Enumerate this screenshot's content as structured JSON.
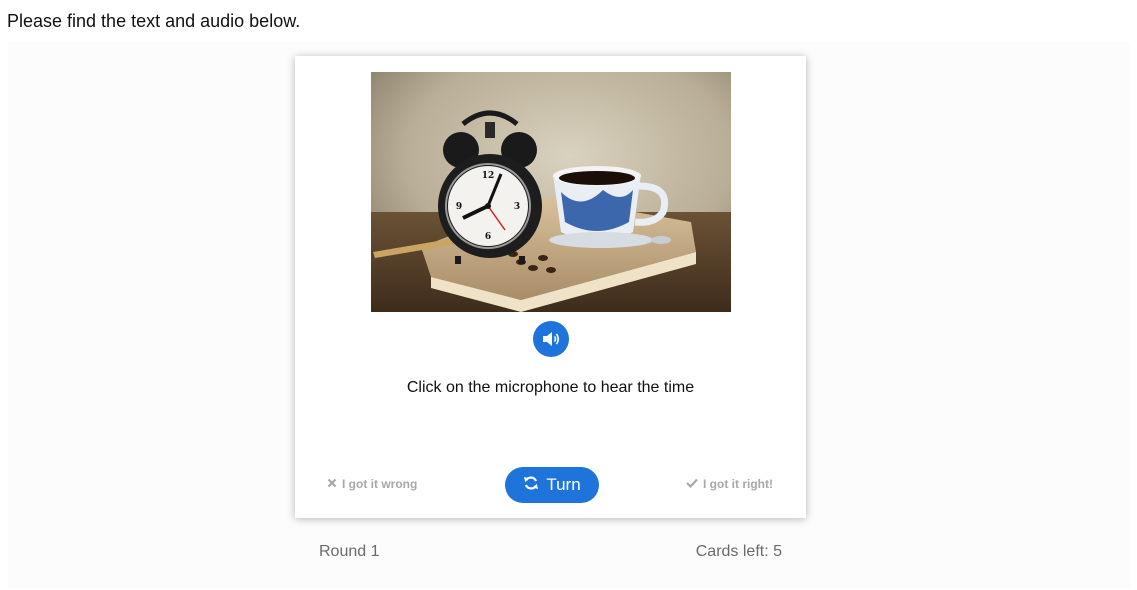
{
  "intro_text": "Please find the text and audio below.",
  "card": {
    "image_alt": "Alarm clock and coffee cup on a book",
    "audio_button_icon": "speaker-icon",
    "text": "Click on the microphone to hear the time",
    "wrong_label": "I got it wrong",
    "right_label": "I got it right!",
    "turn_label": "Turn"
  },
  "footer": {
    "round_label": "Round 1",
    "cards_left_label": "Cards left: 5"
  },
  "colors": {
    "accent": "#1f74dc",
    "muted": "#a8a8a8"
  }
}
